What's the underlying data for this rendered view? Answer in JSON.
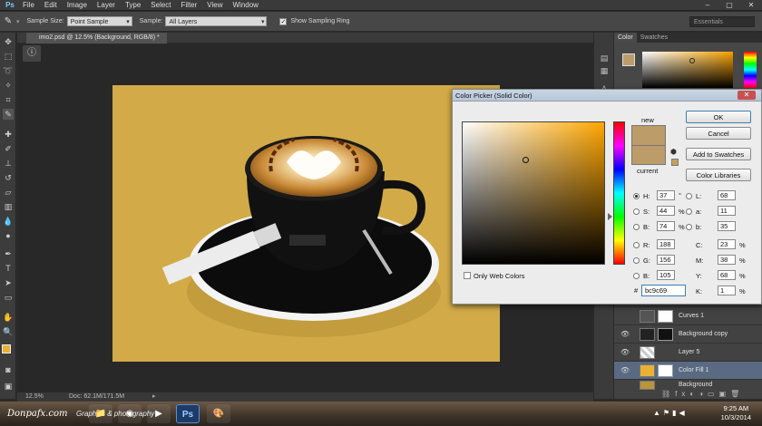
{
  "menubar": {
    "logo": "Ps",
    "items": [
      "File",
      "Edit",
      "Image",
      "Layer",
      "Type",
      "Select",
      "Filter",
      "View",
      "Window"
    ],
    "window_controls": [
      "–",
      "▢",
      "✕"
    ]
  },
  "options": {
    "sample_size_label": "Sample Size:",
    "sample_size_value": "Point Sample",
    "sample_label": "Sample:",
    "sample_value": "All Layers",
    "show_ring_label": "Show Sampling Ring",
    "show_ring_checked": true,
    "workspace": "Essentials"
  },
  "document": {
    "tab_title": "imo2.psd @ 12.5% (Background, RGB/8) *",
    "zoom": "12.5%",
    "doc_size": "Doc: 62.1M/171.5M",
    "canvas_color": "#d2ab48"
  },
  "color_panel": {
    "tabs": [
      "Color",
      "Swatches"
    ],
    "foreground": "#bc9c69"
  },
  "layers": [
    {
      "name": "Curves 1",
      "visible": false,
      "selected": false
    },
    {
      "name": "Background copy",
      "visible": true,
      "selected": false
    },
    {
      "name": "Layer 5",
      "visible": true,
      "selected": false
    },
    {
      "name": "Color Fill 1",
      "visible": true,
      "selected": true
    },
    {
      "name": "Background",
      "visible": false,
      "selected": false
    }
  ],
  "picker": {
    "title": "Color Picker (Solid Color)",
    "new_label": "new",
    "current_label": "current",
    "new_color": "#bc9c69",
    "current_color": "#bc9c69",
    "buttons": {
      "ok": "OK",
      "cancel": "Cancel",
      "add_swatches": "Add to Swatches",
      "color_libraries": "Color Libraries"
    },
    "only_web_label": "Only Web Colors",
    "fields": {
      "H": "37",
      "S": "44",
      "B": "74",
      "R": "188",
      "G": "156",
      "Bb": "105",
      "L": "68",
      "a": "11",
      "b": "35",
      "C": "23",
      "M": "38",
      "Y": "68",
      "K": "1"
    },
    "labels": {
      "H": "H:",
      "S": "S:",
      "B": "B:",
      "R": "R:",
      "G": "G:",
      "Bb": "B:",
      "L": "L:",
      "a": "a:",
      "b": "b:",
      "C": "C:",
      "M": "M:",
      "Y": "Y:",
      "K": "K:",
      "deg": "°",
      "pct": "%",
      "hash": "#"
    },
    "hex": "bc9c69",
    "selected_mode": "H"
  },
  "taskbar": {
    "brand": "Donpafx.com",
    "tagline": "Graphics & photography",
    "time": "9:25 AM",
    "date": "10/3/2014"
  }
}
